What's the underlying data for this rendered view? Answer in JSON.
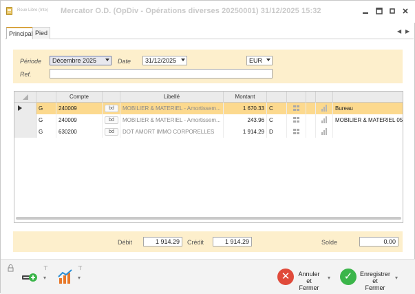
{
  "window": {
    "app_name": "Roue Libre (Inte)",
    "title": "Mercator   O.D.  (OpDiv - Opérations diverses 20250001)   31/12/2025 15:32"
  },
  "tabs": [
    {
      "label": "Principal",
      "active": true
    },
    {
      "label": "Pied",
      "active": false
    }
  ],
  "filter": {
    "periode_label": "Période",
    "periode_value": "Décembre 2025",
    "date_label": "Date",
    "date_value": "31/12/2025",
    "currency_value": "EUR",
    "ref_label": "Ref.",
    "ref_value": ""
  },
  "grid": {
    "columns": [
      "",
      "",
      "Compte",
      "",
      "Libellé",
      "Montant",
      "",
      "",
      "",
      "",
      ""
    ],
    "rows": [
      {
        "type": "G",
        "compte": "240009",
        "bd": "bd",
        "libelle": "MOBILIER & MATERIEL - Amortissem...",
        "montant": "1 670.33",
        "sens": "C",
        "extra": "Bureau",
        "selected": true
      },
      {
        "type": "G",
        "compte": "240009",
        "bd": "bd",
        "libelle": "MOBILIER & MATERIEL - Amortissem...",
        "montant": "243.96",
        "sens": "C",
        "extra": "MOBILIER & MATERIEL 05",
        "selected": false
      },
      {
        "type": "G",
        "compte": "630200",
        "bd": "bd",
        "libelle": "DOT AMORT IMMO CORPORELLES",
        "montant": "1 914.29",
        "sens": "D",
        "extra": "",
        "selected": false
      }
    ]
  },
  "totals": {
    "debit_label": "Débit",
    "debit_value": "1 914.29",
    "credit_label": "Crédit",
    "credit_value": "1 914.29",
    "solde_label": "Solde",
    "solde_value": "0.00"
  },
  "footer": {
    "cancel_label_1": "Annuler et",
    "cancel_label_2": "Fermer",
    "save_label_1": "Enregistrer et",
    "save_label_2": "Fermer"
  },
  "colors": {
    "panel": "#fdefcc",
    "selected_row": "#fcd98e",
    "cancel": "#e04a3a",
    "save": "#3bb54a"
  },
  "icons": [
    "app-icon",
    "minimize-icon",
    "maximize-icon",
    "restore-icon",
    "close-icon",
    "lock-icon",
    "add-entry-icon",
    "chart-icon",
    "pin-icon",
    "grid-view-icon",
    "bar-chart-icon"
  ]
}
